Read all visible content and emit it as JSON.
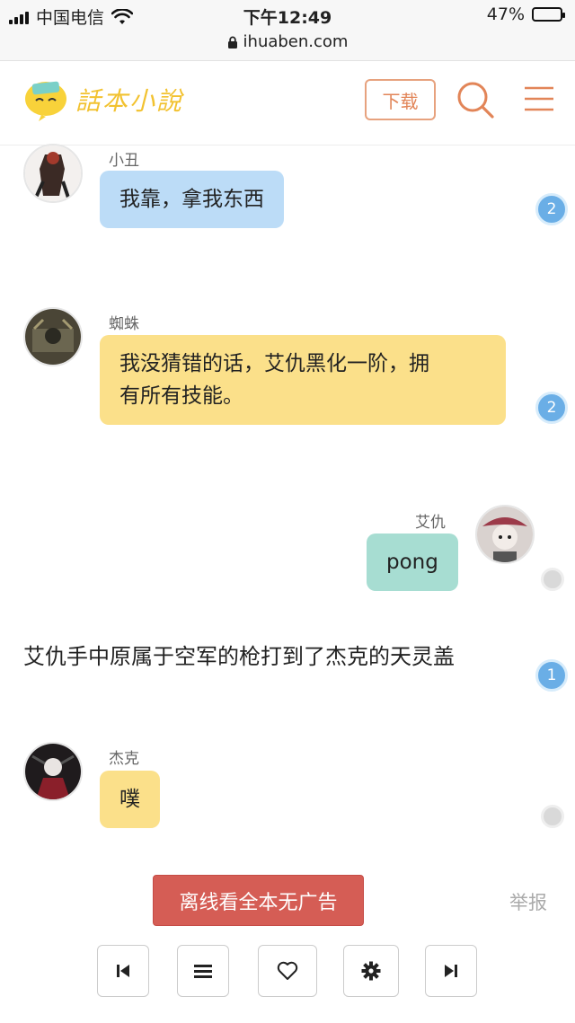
{
  "status_bar": {
    "carrier": "中国电信",
    "time": "下午12:49",
    "battery": "47%",
    "battery_level": 0.47
  },
  "url_bar": {
    "domain": "ihuaben.com"
  },
  "header": {
    "logo_text": "話本小說",
    "download_label": "下载",
    "accent_color": "#e28558"
  },
  "messages": [
    {
      "speaker": "小丑",
      "text": "我靠，拿我东西",
      "badge": "2",
      "side": "left",
      "color": "blue"
    },
    {
      "speaker": "蜘蛛",
      "text_line1": "我没猜错的话，艾仇黑化一阶，拥",
      "text_line2": "有所有技能。",
      "badge": "2",
      "side": "left",
      "color": "yellow"
    },
    {
      "speaker": "艾仇",
      "text": "pong",
      "badge": "",
      "side": "right",
      "color": "teal"
    },
    {
      "speaker": "杰克",
      "text": "噗",
      "badge": "",
      "side": "left",
      "color": "yellow"
    }
  ],
  "narration": {
    "text": "艾仇手中原属于空军的枪打到了杰克的天灵盖",
    "badge": "1"
  },
  "footer": {
    "offline_label": "离线看全本无广告",
    "report_label": "举报",
    "nav": [
      "first-page-icon",
      "list-icon",
      "heart-icon",
      "gear-icon",
      "last-page-icon"
    ]
  }
}
